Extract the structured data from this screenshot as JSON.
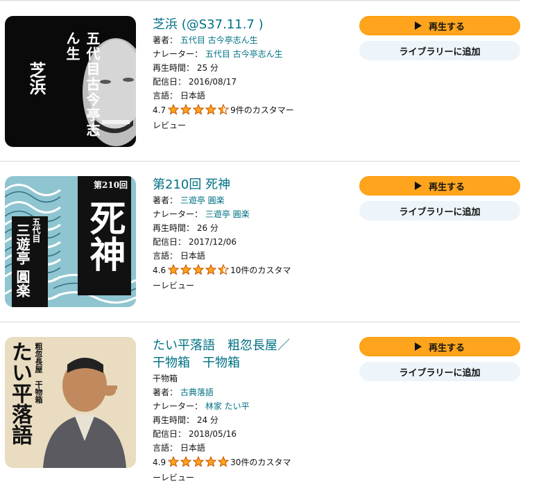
{
  "items": [
    {
      "title": "芝浜 (@S37.11.7 )",
      "subtitle": "",
      "author_label": "著者：",
      "author": "五代目 古今亭志ん生",
      "narrator_label": "ナレーター：",
      "narrator": "五代目 古今亭志ん生",
      "length_label": "再生時間：",
      "length": "25 分",
      "date_label": "配信日：",
      "date": "2016/08/17",
      "lang_label": "言語：",
      "lang": "日本語",
      "rating_value": "4.7",
      "stars": 4.5,
      "reviews_line1": "9件のカスタマー",
      "reviews_line2": "レビュー",
      "play_label": "再生する",
      "library_label": "ライブラリーに追加",
      "cover": {
        "vertical_name": "五代目古今亭志ん生",
        "vertical_title": "芝浜"
      }
    },
    {
      "title": "第210回 死神",
      "subtitle": "",
      "author_label": "著者：",
      "author": "三遊亭 圓楽",
      "narrator_label": "ナレーター：",
      "narrator": "三遊亭 圓楽",
      "length_label": "再生時間：",
      "length": "26 分",
      "date_label": "配信日：",
      "date": "2017/12/06",
      "lang_label": "言語：",
      "lang": "日本語",
      "rating_value": "4.6",
      "stars": 4.5,
      "reviews_line1": "10件のカスタマ",
      "reviews_line2": "ーレビュー",
      "play_label": "再生する",
      "library_label": "ライブラリーに追加",
      "cover": {
        "episode": "第210回",
        "vertical_title": "死神",
        "gen": "五代目",
        "vertical_name": "三遊亭 圓楽"
      }
    },
    {
      "title_line1": "たい平落語　粗忽長屋／",
      "title_line2": "干物箱　干物箱",
      "subtitle": "干物箱",
      "author_label": "著者：",
      "author": "古典落語",
      "narrator_label": "ナレーター：",
      "narrator": "林家 たい平",
      "length_label": "再生時間：",
      "length": "24 分",
      "date_label": "配信日：",
      "date": "2018/05/16",
      "lang_label": "言語：",
      "lang": "日本語",
      "rating_value": "4.9",
      "stars": 5,
      "reviews_line1": "30件のカスタマ",
      "reviews_line2": "ーレビュー",
      "play_label": "再生する",
      "library_label": "ライブラリーに追加",
      "cover": {
        "vertical_title": "たい平落語",
        "vertical_sub": "粗忽長屋　干物箱"
      }
    }
  ],
  "colors": {
    "link": "#007185",
    "play": "#ffa41c",
    "library": "#edf4fa",
    "star": "#ffa41c"
  }
}
